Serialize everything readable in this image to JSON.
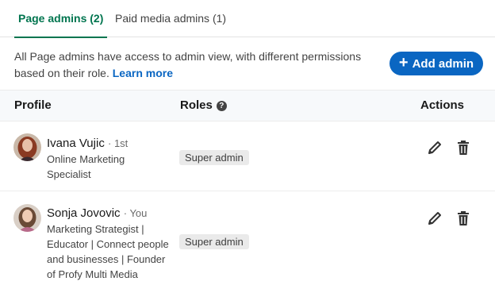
{
  "tabs": [
    {
      "label": "Page admins (2)",
      "active": true
    },
    {
      "label": "Paid media admins (1)",
      "active": false
    }
  ],
  "intro": {
    "text": "All Page admins have access to admin view, with different permissions based on their role.",
    "link": "Learn more"
  },
  "add_button": {
    "icon": "plus-icon",
    "label": "Add admin"
  },
  "table": {
    "headers": {
      "profile": "Profile",
      "roles": "Roles",
      "actions": "Actions"
    },
    "rows": [
      {
        "name": "Ivana Vujic",
        "degree": "· 1st",
        "headline": [
          "Online Marketing",
          "Specialist"
        ],
        "role": "Super admin"
      },
      {
        "name": "Sonja Jovovic",
        "degree": "· You",
        "headline": [
          "Marketing Strategist |",
          "Educator | Connect people",
          "and businesses | Founder",
          "of Profy Multi Media"
        ],
        "role": "Super admin"
      }
    ]
  },
  "colors": {
    "accent_green": "#01754f",
    "primary_blue": "#0a66c2",
    "header_bg": "#f7f9fb"
  }
}
